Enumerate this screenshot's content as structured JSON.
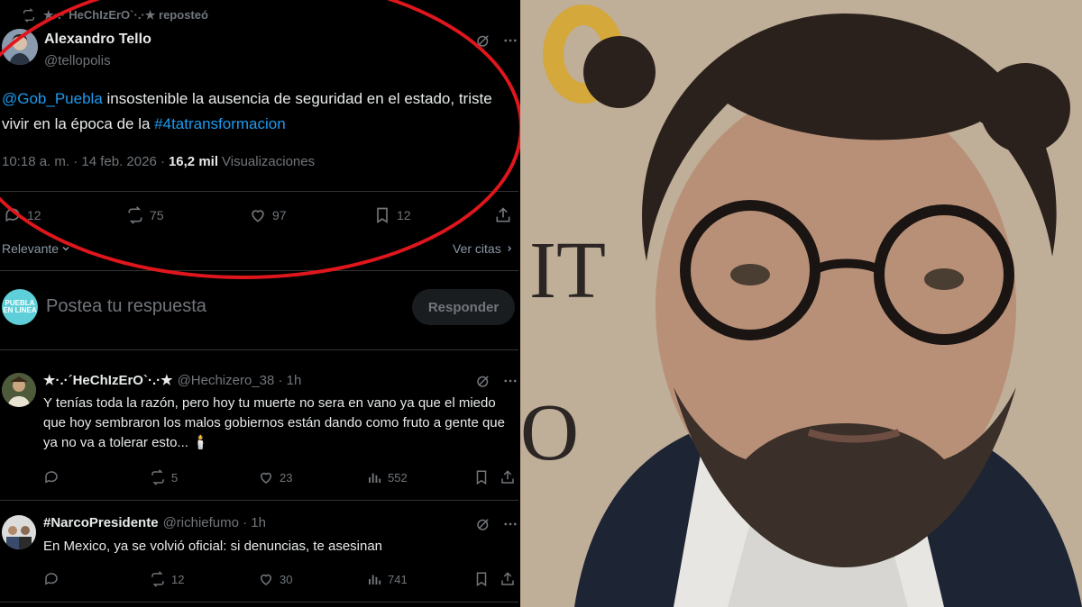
{
  "repost": {
    "label": "★·.·´HeChIzErO`·.·★ reposteó"
  },
  "tweet": {
    "name": "Alexandro Tello",
    "handle": "@tellopolis",
    "mention": "@Gob_Puebla",
    "text_mid": " insostenible la ausencia de seguridad en el estado, triste vivir en la época de la ",
    "hashtag": "#4tatransformacion",
    "time": "10:18 a. m. · 14 feb. 2026 ·",
    "views_count": "16,2 mil",
    "views_label": "Visualizaciones",
    "replies": "12",
    "reposts": "75",
    "likes": "97",
    "bookmarks": "12"
  },
  "sort": {
    "label": "Relevante",
    "quotes": "Ver citas"
  },
  "reply_box": {
    "avatar_text": "PUEBLA EN LINEA",
    "placeholder": "Postea tu respuesta",
    "button": "Responder"
  },
  "comments": [
    {
      "name": "★·.·´HeChIzErO`·.·★",
      "handle": "@Hechizero_38 · 1h",
      "text": "Y tenías toda la razón, pero hoy tu muerte no sera en vano ya que el miedo que hoy sembraron los malos gobiernos están dando como fruto a gente que ya no va a tolerar esto... 🕯️",
      "reposts": "5",
      "likes": "23",
      "views": "552"
    },
    {
      "name": "#NarcoPresidente",
      "handle": "@richiefumo · 1h",
      "text": "En Mexico, ya se volvió oficial: si denuncias, te asesinan",
      "reposts": "12",
      "likes": "30",
      "views": "741"
    }
  ],
  "colors": {
    "link": "#1d9bf0",
    "muted": "#71767b",
    "ring": "#e0161d",
    "background": "#000000"
  }
}
